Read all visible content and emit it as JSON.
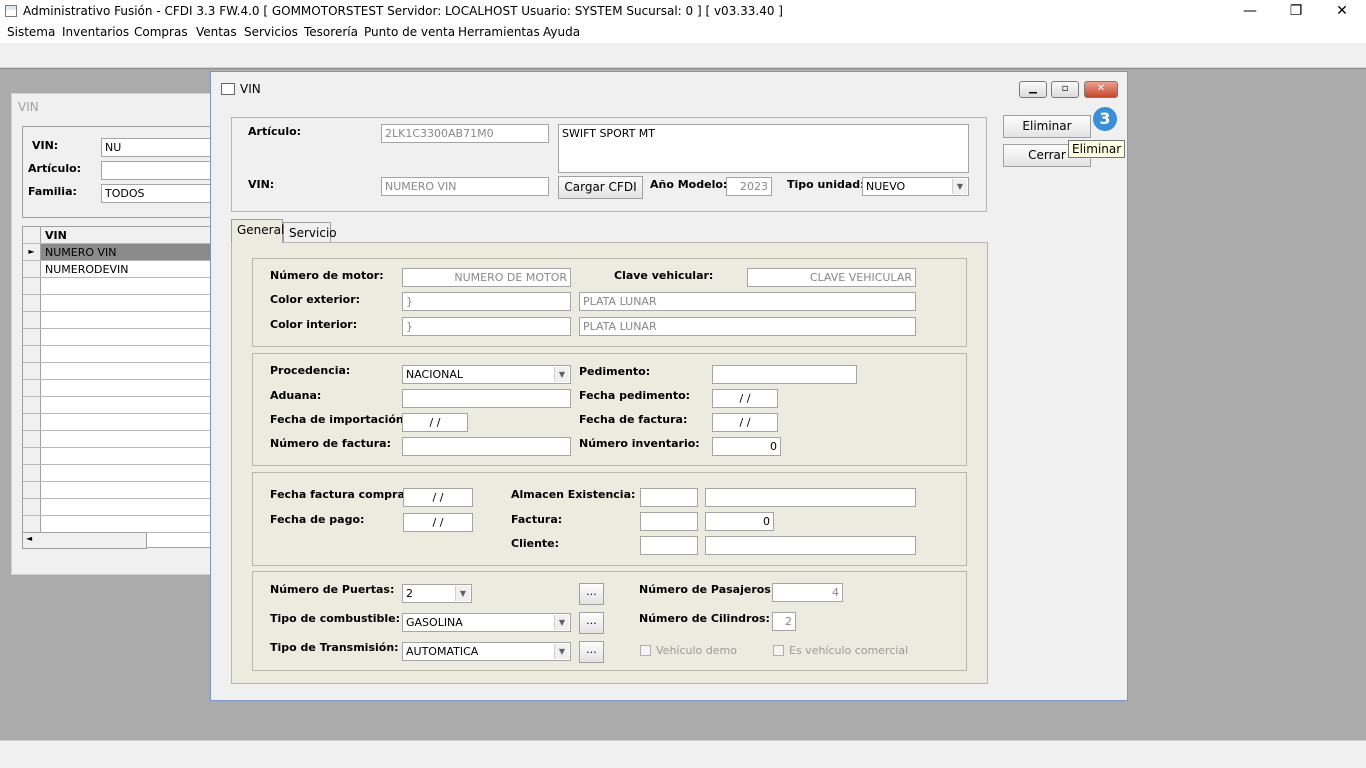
{
  "app": {
    "title": "Administrativo Fusión - CFDI 3.3 FW.4.0 [ GOMMOTORSTEST   Servidor: LOCALHOST   Usuario: SYSTEM     Sucursal: 0 ] [ v03.33.40 ]",
    "controls": {
      "minimize": "—",
      "restore": "❐",
      "close": "✕"
    }
  },
  "menu": [
    "Sistema",
    "Inventarios",
    "Compras",
    "Ventas",
    "Servicios",
    "Tesorería",
    "Punto de venta",
    "Herramientas",
    "Ayuda"
  ],
  "bg_window": {
    "title": "VIN",
    "vin_label": "VIN:",
    "vin_value": "NU",
    "articulo_label": "Artículo:",
    "articulo_value": "",
    "familia_label": "Familia:",
    "familia_value": "TODOS",
    "grid_header": "VIN",
    "rows": [
      "NUMERO VIN",
      "NUMERODEVIN"
    ],
    "row_indicator": "►",
    "scroll_left": "◄"
  },
  "dialog": {
    "title": "VIN",
    "articulo_label": "Artículo:",
    "articulo_code": "2LK1C3300AB71M0",
    "articulo_desc": "SWIFT SPORT MT",
    "vin_label": "VIN:",
    "vin_value": "NUMERO VIN",
    "cargar_cfdi": "Cargar CFDI",
    "anio_label": "Año Modelo:",
    "anio_value": "2023",
    "tipo_unidad_label": "Tipo unidad:",
    "tipo_unidad_value": "NUEVO",
    "eliminar": "Eliminar",
    "cerrar": "Cerrar",
    "badge": "3",
    "tooltip": "Eliminar",
    "tabs": [
      "General",
      "Servicio"
    ],
    "sec1": {
      "motor_label": "Número de motor:",
      "motor_value": "NUMERO DE MOTOR",
      "clave_label": "Clave vehicular:",
      "clave_value": "CLAVE VEHICULAR",
      "color_ext_label": "Color exterior:",
      "color_ext_code": "}",
      "color_ext_name": "PLATA LUNAR",
      "color_int_label": "Color interior:",
      "color_int_code": "}",
      "color_int_name": "PLATA LUNAR"
    },
    "sec2": {
      "procedencia_label": "Procedencia:",
      "procedencia_value": "NACIONAL",
      "pedimento_label": "Pedimento:",
      "pedimento_value": "",
      "aduana_label": "Aduana:",
      "aduana_value": "",
      "fecha_pedimento_label": "Fecha pedimento:",
      "fecha_pedimento_value": "/ /",
      "fecha_import_label": "Fecha de importación:",
      "fecha_import_value": "/ /",
      "fecha_factura_label": "Fecha de factura:",
      "fecha_factura_value": "/ /",
      "num_factura_label": "Número de factura:",
      "num_factura_value": "",
      "num_inventario_label": "Número inventario:",
      "num_inventario_value": "0"
    },
    "sec3": {
      "fecha_fact_compra_label": "Fecha factura compra:",
      "fecha_fact_compra_value": "/ /",
      "fecha_pago_label": "Fecha de pago:",
      "fecha_pago_value": "/ /",
      "almacen_label": "Almacen Existencia:",
      "factura_label": "Factura:",
      "factura_value": "0",
      "cliente_label": "Cliente:"
    },
    "sec4": {
      "puertas_label": "Número de Puertas:",
      "puertas_value": "2",
      "combustible_label": "Tipo de combustible:",
      "combustible_value": "GASOLINA",
      "transmision_label": "Tipo de Transmisión:",
      "transmision_value": "AUTOMATICA",
      "pasajeros_label": "Número de Pasajeros:",
      "pasajeros_value": "4",
      "cilindros_label": "Número de Cilindros:",
      "cilindros_value": "2",
      "vehiculo_demo": "Vehículo demo",
      "es_comercial": "Es vehículo comercial",
      "ellipsis": "..."
    }
  }
}
